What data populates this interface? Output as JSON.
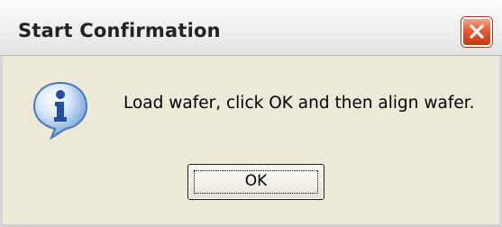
{
  "dialog": {
    "title": "Start Confirmation",
    "icon": "information-icon",
    "message": "Load wafer, click OK and then align wafer.",
    "ok_label": "OK",
    "close_icon": "close-icon"
  }
}
